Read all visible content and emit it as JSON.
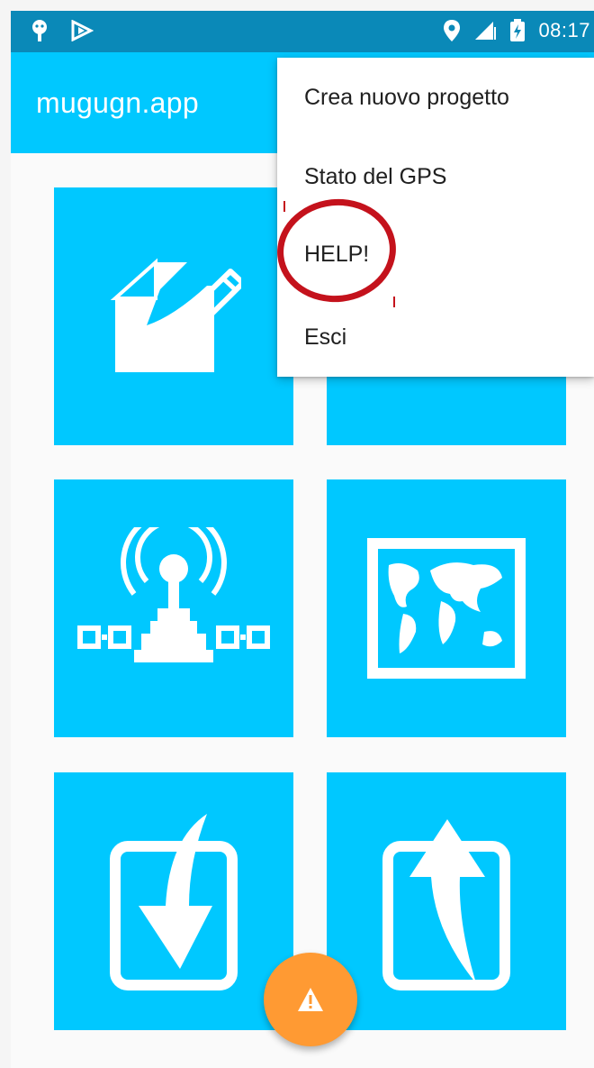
{
  "status_bar": {
    "time": "08:17"
  },
  "app_bar": {
    "title": "mugugn.app"
  },
  "menu": {
    "items": [
      {
        "label": "Crea nuovo progetto"
      },
      {
        "label": "Stato del GPS"
      },
      {
        "label": "HELP!"
      },
      {
        "label": "Esci"
      }
    ]
  },
  "tiles": [
    {
      "icon": "new-document-pencil-icon"
    },
    {
      "icon": "grid-icon"
    },
    {
      "icon": "gps-antenna-icon"
    },
    {
      "icon": "world-map-icon"
    },
    {
      "icon": "import-arrow-icon"
    },
    {
      "icon": "export-arrow-icon"
    }
  ],
  "fab": {
    "icon": "warning-icon"
  },
  "colors": {
    "status_bar": "#0a89b8",
    "primary": "#00c8ff",
    "fab": "#ff9a33",
    "highlight": "#c4121c"
  }
}
